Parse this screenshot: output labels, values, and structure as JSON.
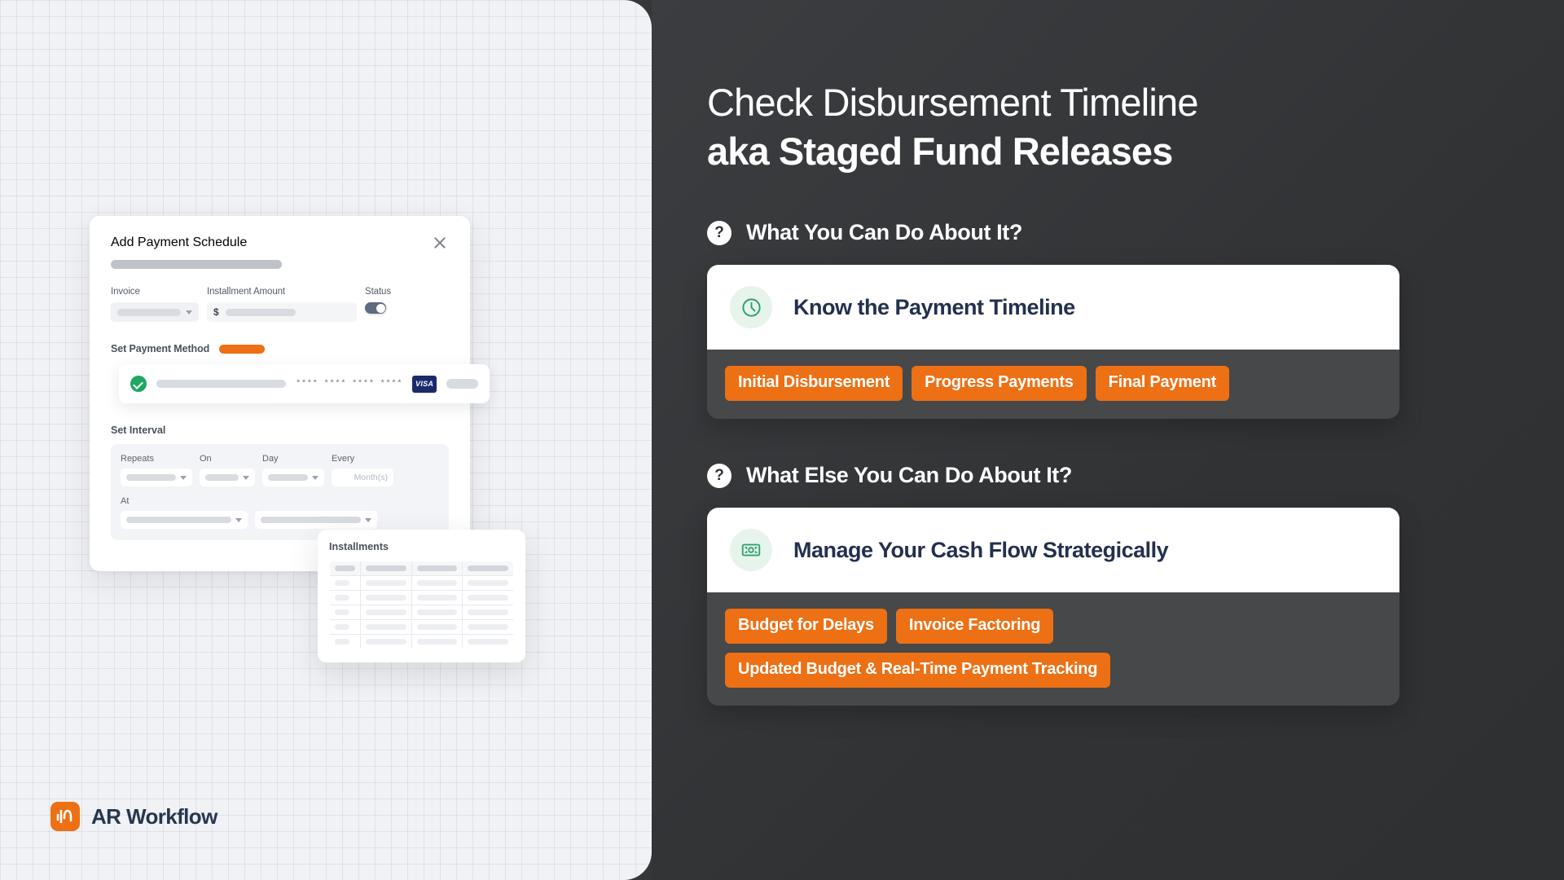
{
  "brand": {
    "name": "AR Workflow",
    "accent_orange": "#ED7014",
    "navy": "#27364F",
    "green": "#2AA06A",
    "panel_dark": "#303234",
    "tag_strip": "#474849"
  },
  "hero": {
    "line1": "Check Disbursement Timeline",
    "line2": "aka Staged Fund Releases"
  },
  "sections": [
    {
      "icon": "question-mark-icon",
      "title": "What You Can Do About It?",
      "card": {
        "icon": "clock-icon",
        "title": "Know the Payment Timeline",
        "tags": [
          "Initial Disbursement",
          "Progress Payments",
          "Final Payment"
        ]
      }
    },
    {
      "icon": "question-mark-icon",
      "title": "What Else You Can Do About It?",
      "card": {
        "icon": "banknote-icon",
        "title": "Manage Your Cash Flow Strategically",
        "tags": [
          "Budget for Delays",
          "Invoice Factoring",
          "Updated Budget & Real-Time Payment Tracking"
        ]
      }
    }
  ],
  "mock": {
    "modal_title": "Add Payment Schedule",
    "close_icon": "close-icon",
    "fields": {
      "invoice_label": "Invoice",
      "installment_label": "Installment Amount",
      "status_label": "Status",
      "currency_symbol": "$",
      "status_toggle_on": true
    },
    "payment_method": {
      "section_label": "Set Payment Method",
      "verified_icon": "check-circle-icon",
      "masked_card": "**** **** **** ****",
      "card_brand": "VISA"
    },
    "interval": {
      "section_label": "Set Interval",
      "repeats_label": "Repeats",
      "on_label": "On",
      "day_label": "Day",
      "every_label": "Every",
      "every_placeholder": "Month(s)",
      "at_label": "At"
    },
    "installments": {
      "title": "Installments",
      "column_count": 4,
      "row_count": 5
    }
  }
}
